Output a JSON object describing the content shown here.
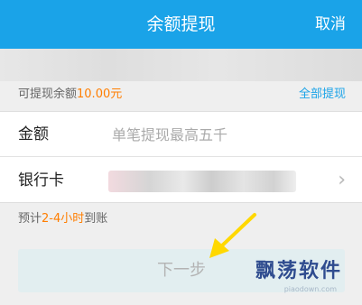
{
  "header": {
    "title": "余额提现",
    "cancel_label": "取消"
  },
  "balance": {
    "label": "可提现余额",
    "value": "10.00元",
    "withdraw_all_label": "全部提现"
  },
  "form": {
    "amount_label": "金额",
    "amount_placeholder": "单笔提现最高五千",
    "amount_value": "",
    "bank_label": "银行卡"
  },
  "eta": {
    "prefix": "预计",
    "highlight": "2-4小时",
    "suffix": "到账"
  },
  "next_button_label": "下一步",
  "watermark": {
    "text": "飘荡软件",
    "url": "piaodown.com"
  },
  "colors": {
    "header": "#1aa3e8",
    "accent_orange": "#ff7e00",
    "link_blue": "#1aa3e8",
    "arrow_yellow": "#ffd800"
  }
}
